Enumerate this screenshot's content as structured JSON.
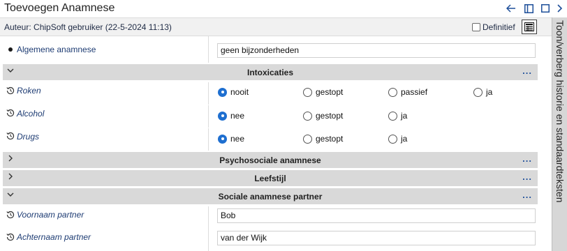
{
  "window": {
    "title": "Toevoegen Anamnese",
    "back_icon": "arrow-left-icon",
    "dock_icon": "dock-panel-icon",
    "maximize_icon": "maximize-icon",
    "close_icon": "chevron-right-icon"
  },
  "author": {
    "text": "Auteur: ChipSoft gebruiker (22-5-2024 11:13)",
    "definitief_label": "Definitief",
    "definitief_checked": false,
    "grid_icon": "table-grid-icon"
  },
  "sidebar": {
    "label": "Toon/verberg historie en standaardteksten"
  },
  "general": {
    "label": "Algemene anamnese",
    "value": "geen bijzonderheden"
  },
  "sections": {
    "intoxicaties": {
      "title": "Intoxicaties",
      "expanded": true,
      "more": "..."
    },
    "psychosociale": {
      "title": "Psychosociale anamnese",
      "expanded": false,
      "more": "..."
    },
    "leefstijl": {
      "title": "Leefstijl",
      "expanded": false,
      "more": "..."
    },
    "sociale_partner": {
      "title": "Sociale anamnese partner",
      "expanded": true,
      "more": "..."
    }
  },
  "intoxicaties": {
    "roken": {
      "label": "Roken",
      "options": [
        "nooit",
        "gestopt",
        "passief",
        "ja"
      ],
      "selected": "nooit"
    },
    "alcohol": {
      "label": "Alcohol",
      "options": [
        "nee",
        "gestopt",
        "ja"
      ],
      "selected": "nee"
    },
    "drugs": {
      "label": "Drugs",
      "options": [
        "nee",
        "gestopt",
        "ja"
      ],
      "selected": "nee"
    }
  },
  "partner": {
    "voornaam_label": "Voornaam partner",
    "voornaam_value": "Bob",
    "achternaam_label": "Achternaam partner",
    "achternaam_value": "van der Wijk"
  },
  "colors": {
    "accent": "#1e6fd0",
    "section_bg": "#d9d9d9",
    "label_text": "#1e3c73"
  }
}
